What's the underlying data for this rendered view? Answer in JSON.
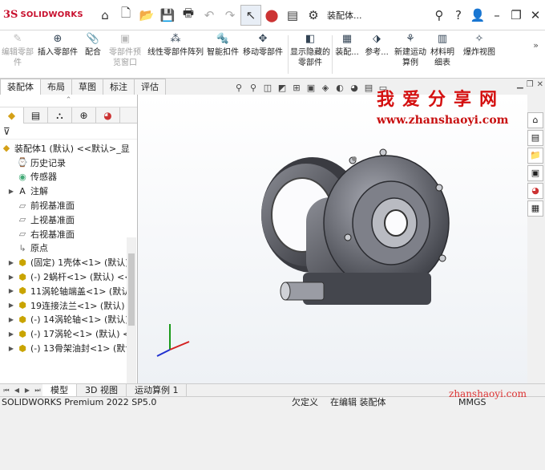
{
  "app": {
    "logo_ds": "3S",
    "logo_name": "SOLIDWORKS",
    "doc_title": "装配体..."
  },
  "toolbar": {
    "icons": [
      "home-icon",
      "new-icon",
      "open-icon",
      "save-icon",
      "print-icon",
      "undo-icon",
      "redo-icon",
      "select-icon",
      "traffic-light-icon",
      "file-properties-icon",
      "gear-icon"
    ],
    "window_controls": [
      "search-icon",
      "help-icon",
      "user-icon"
    ]
  },
  "ribbon": {
    "buttons": [
      {
        "label": "编辑零部件",
        "disabled": true
      },
      {
        "label": "插入零部件",
        "disabled": false
      },
      {
        "label": "配合",
        "disabled": false
      },
      {
        "label": "零部件预览窗口",
        "disabled": true
      },
      {
        "label": "线性零部件阵列",
        "disabled": false
      },
      {
        "label": "智能扣件",
        "disabled": false
      },
      {
        "label": "移动零部件",
        "disabled": false
      },
      {
        "label": "显示隐藏的零部件",
        "disabled": false
      },
      {
        "label": "装配...",
        "disabled": false
      },
      {
        "label": "参考...",
        "disabled": false
      },
      {
        "label": "新建运动算例",
        "disabled": false
      },
      {
        "label": "材料明细表",
        "disabled": false
      },
      {
        "label": "爆炸视图",
        "disabled": false
      }
    ]
  },
  "cmd_tabs": [
    "装配体",
    "布局",
    "草图",
    "标注",
    "评估"
  ],
  "active_cmd_tab": "装配体",
  "tree": {
    "root": "装配体1 (默认) <<默认>_显",
    "items": [
      {
        "label": "历史记录",
        "icon": "history-icon",
        "expand": false
      },
      {
        "label": "传感器",
        "icon": "sensor-icon",
        "expand": false
      },
      {
        "label": "注解",
        "icon": "annotation-icon",
        "expand": true
      },
      {
        "label": "前视基准面",
        "icon": "plane-icon",
        "expand": false
      },
      {
        "label": "上视基准面",
        "icon": "plane-icon",
        "expand": false
      },
      {
        "label": "右视基准面",
        "icon": "plane-icon",
        "expand": false
      },
      {
        "label": "原点",
        "icon": "origin-icon",
        "expand": false
      },
      {
        "label": "(固定) 1壳体<1> (默认)",
        "icon": "part-icon",
        "expand": true
      },
      {
        "label": "(-) 2蜗杆<1> (默认) <<",
        "icon": "part-icon",
        "expand": true
      },
      {
        "label": "11涡轮轴端盖<1> (默认",
        "icon": "part-icon",
        "expand": true
      },
      {
        "label": "19连接法兰<1> (默认)",
        "icon": "part-icon",
        "expand": true
      },
      {
        "label": "(-) 14涡轮轴<1> (默认)",
        "icon": "part-icon",
        "expand": true
      },
      {
        "label": "(-) 17涡轮<1> (默认) <",
        "icon": "part-icon",
        "expand": true
      },
      {
        "label": "(-) 13骨架油封<1> (默认",
        "icon": "part-icon",
        "expand": true
      }
    ]
  },
  "bottom_tabs": [
    "模型",
    "3D 视图",
    "运动算例 1"
  ],
  "active_bottom_tab": "模型",
  "status": {
    "version": "SOLIDWORKS Premium 2022 SP5.0",
    "state": "欠定义",
    "mode": "在编辑 装配体",
    "units": "MMGS"
  },
  "watermark": {
    "title": "我爱分享网",
    "url": "www.zhanshaoyi.com",
    "url2": "zhanshaoyi.com"
  },
  "colors": {
    "brand": "#c8102e",
    "watermark": "#d41010"
  }
}
